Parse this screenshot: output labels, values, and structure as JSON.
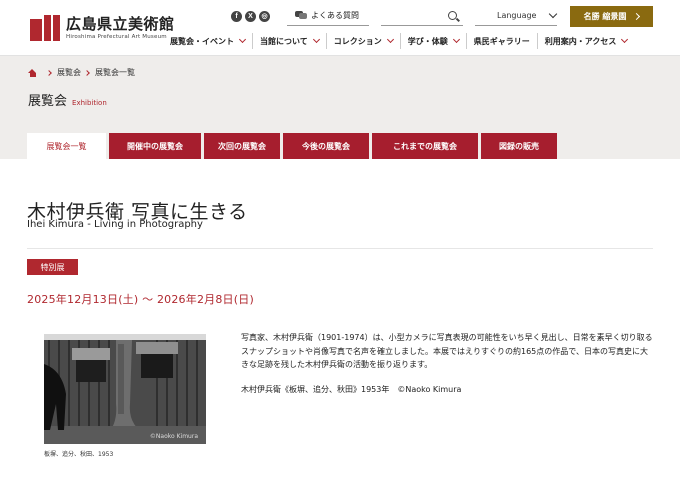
{
  "header": {
    "logo_ja": "広島県立美術館",
    "logo_en": "Hiroshima Prefectural Art Museum",
    "social": [
      "f",
      "X",
      "◎"
    ],
    "faq_label": "よくある質問",
    "search_placeholder": "",
    "language_label": "Language",
    "member_label": "名勝 縮景園"
  },
  "nav": [
    "展覧会・イベント",
    "当館について",
    "コレクション",
    "学び・体験",
    "県民ギャラリー",
    "利用案内・アクセス"
  ],
  "breadcrumb": [
    "展覧会",
    "展覧会一覧"
  ],
  "section": {
    "title_ja": "展覧会",
    "title_en": "Exhibition"
  },
  "tabs": [
    "展覧会一覧",
    "開催中の展覧会",
    "次回の展覧会",
    "今後の展覧会",
    "これまでの展覧会",
    "図録の販売"
  ],
  "exhibition": {
    "title_ja": "木村伊兵衛 写真に生きる",
    "title_en": "Ihei Kimura - Living in Photography",
    "badge": "特別展",
    "dates": "2025年12月13日(土) 〜 2026年2月8日(日)",
    "photo_credit": "©Naoko Kimura",
    "photo_caption": "板塀、追分、秋田、1953",
    "description": "写真家、木村伊兵衛（1901-1974）は、小型カメラに写真表現の可能性をいち早く見出し、日常を素早く切り取るスナップショットや肖像写真で名声を確立しました。本展ではえりすぐりの約165点の作品で、日本の写真史に大きな足跡を残した木村伊兵衛の活動を振り返ります。",
    "credit": "木村伊兵衛《板塀、追分、秋田》1953年　©Naoko Kimura"
  },
  "colors": {
    "accent": "#b0282f",
    "tab": "#a61e2e",
    "member": "#8a6a10",
    "band": "#efedeb"
  }
}
